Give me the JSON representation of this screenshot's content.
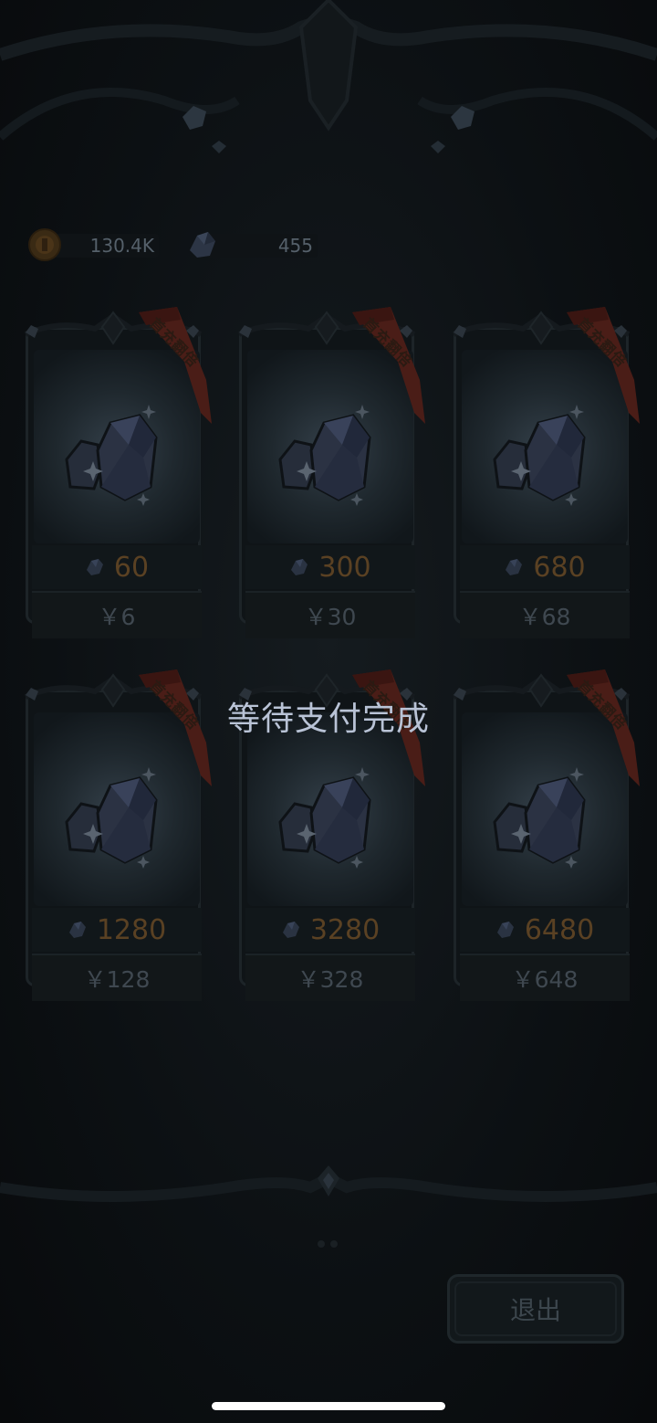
{
  "currencies": {
    "gold": {
      "icon": "gold-coin-icon",
      "value": "130.4K"
    },
    "gem": {
      "icon": "gem-icon",
      "value": "455"
    }
  },
  "ribbon_text": "首充翻倍",
  "packs": [
    {
      "gems": "60",
      "price": "￥6"
    },
    {
      "gems": "300",
      "price": "￥30"
    },
    {
      "gems": "680",
      "price": "￥68"
    },
    {
      "gems": "1280",
      "price": "￥128"
    },
    {
      "gems": "3280",
      "price": "￥328"
    },
    {
      "gems": "6480",
      "price": "￥648"
    }
  ],
  "overlay_message": "等待支付完成",
  "exit_label": "退出",
  "colors": {
    "gold_amount": "#5a4123",
    "ribbon": "#4a1d17",
    "overlay_text": "#b9c3d6"
  }
}
